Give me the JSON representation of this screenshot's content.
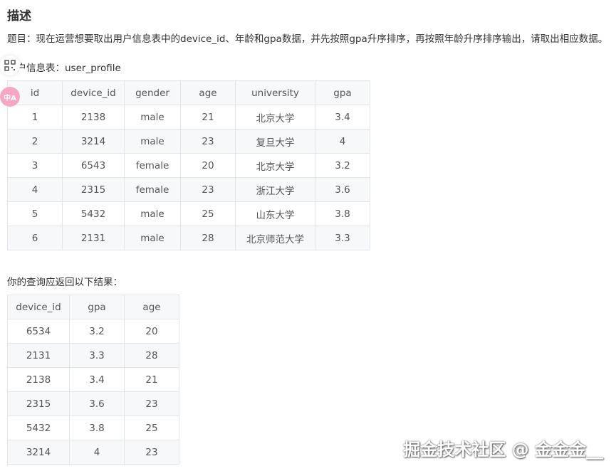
{
  "heading": "描述",
  "prompt": "题目：现在运营想要取出用户信息表中的device_id、年龄和gpa数据，并先按照gpa升序排序，再按照年龄升序排序输出，请取出相应数据。",
  "table_caption": "用户信息表：user_profile",
  "profile_table": {
    "headers": [
      "id",
      "device_id",
      "gender",
      "age",
      "university",
      "gpa"
    ],
    "rows": [
      [
        "1",
        "2138",
        "male",
        "21",
        "北京大学",
        "3.4"
      ],
      [
        "2",
        "3214",
        "male",
        "23",
        "复旦大学",
        "4"
      ],
      [
        "3",
        "6543",
        "female",
        "20",
        "北京大学",
        "3.2"
      ],
      [
        "4",
        "2315",
        "female",
        "23",
        "浙江大学",
        "3.6"
      ],
      [
        "5",
        "5432",
        "male",
        "25",
        "山东大学",
        "3.8"
      ],
      [
        "6",
        "2131",
        "male",
        "28",
        "北京师范大学",
        "3.3"
      ]
    ]
  },
  "result_caption": "你的查询应返回以下结果：",
  "result_table": {
    "headers": [
      "device_id",
      "gpa",
      "age"
    ],
    "rows": [
      [
        "6534",
        "3.2",
        "20"
      ],
      [
        "2131",
        "3.3",
        "28"
      ],
      [
        "2138",
        "3.4",
        "21"
      ],
      [
        "2315",
        "3.6",
        "23"
      ],
      [
        "5432",
        "3.8",
        "25"
      ],
      [
        "3214",
        "4",
        "23"
      ]
    ]
  },
  "float_buttons": {
    "grid_icon": "qr-grid-icon",
    "translate_icon": "translate-icon",
    "translate_label": "中A"
  },
  "watermark": "掘金技术社区 @ 金金金__"
}
